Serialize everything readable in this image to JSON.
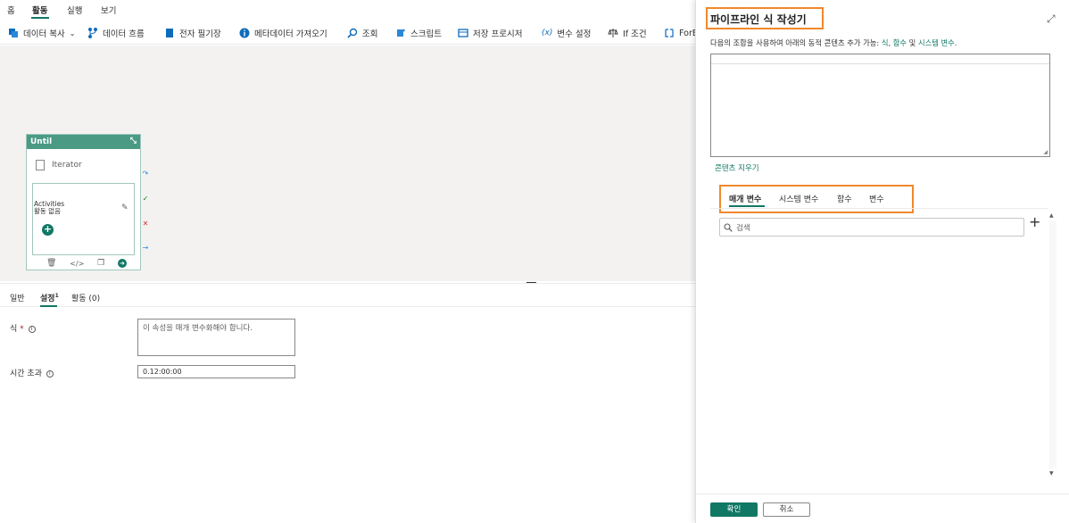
{
  "menu": {
    "items": [
      "홈",
      "활동",
      "실행",
      "보기"
    ],
    "active": "활동"
  },
  "toolbar": {
    "items": [
      {
        "label": "데이터 복사",
        "icon": "copy-data-icon",
        "has_dropdown": true
      },
      {
        "label": "데이터 흐름",
        "icon": "dataflow-icon"
      },
      {
        "label": "전자 필기장",
        "icon": "notebook-icon"
      },
      {
        "label": "메타데이터 가져오기",
        "icon": "info-icon"
      },
      {
        "label": "조회",
        "icon": "lookup-icon"
      },
      {
        "label": "스크립트",
        "icon": "script-icon"
      },
      {
        "label": "저장 프로시저",
        "icon": "stored-procedure-icon"
      },
      {
        "label": "변수 설정",
        "icon": "variable-icon"
      },
      {
        "label": "If 조건",
        "icon": "if-condition-icon"
      },
      {
        "label": "ForE",
        "icon": "foreach-icon"
      }
    ]
  },
  "canvas": {
    "until": {
      "title": "Until",
      "iterator_label": "Iterator",
      "activities_title": "Activities",
      "activities_empty": "활동 없음"
    }
  },
  "bottom_panel": {
    "tabs": [
      {
        "label": "일반"
      },
      {
        "label": "설정",
        "badge": "1"
      },
      {
        "label": "활동 (0)"
      }
    ],
    "active_tab": "설정",
    "expression": {
      "label": "식",
      "required_mark": "*",
      "placeholder": "이 속성을 매개 변수화해야 합니다."
    },
    "timeout": {
      "label": "시간 초과",
      "value": "0.12:00:00"
    }
  },
  "expression_builder": {
    "title": "파이프라인 식 작성기",
    "description_prefix": "다음의 조합을 사용하여 아래의 동적 콘텐츠 추가 가능: ",
    "link_expression": "식",
    "link_functions": "함수",
    "separator_and": " 및 ",
    "link_variables": "시스템 변수",
    "clear_label": "콘텐츠 지우기",
    "tabs": [
      "매개 변수",
      "시스템 변수",
      "함수",
      "변수"
    ],
    "active_tab": "매개 변수",
    "search_placeholder": "검색",
    "ok_label": "확인",
    "cancel_label": "취소"
  },
  "colors": {
    "accent": "#117865",
    "highlight": "#f0882c",
    "until_header": "#4a9a84"
  }
}
